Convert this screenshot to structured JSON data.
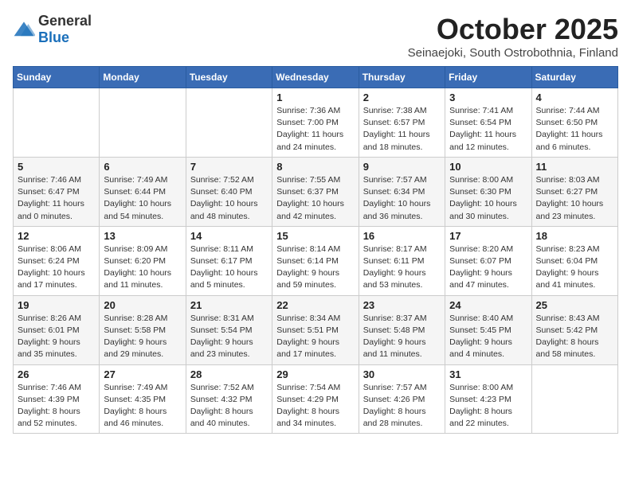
{
  "logo": {
    "general": "General",
    "blue": "Blue"
  },
  "title": "October 2025",
  "subtitle": "Seinaejoki, South Ostrobothnia, Finland",
  "headers": [
    "Sunday",
    "Monday",
    "Tuesday",
    "Wednesday",
    "Thursday",
    "Friday",
    "Saturday"
  ],
  "weeks": [
    [
      {
        "day": "",
        "info": ""
      },
      {
        "day": "",
        "info": ""
      },
      {
        "day": "",
        "info": ""
      },
      {
        "day": "1",
        "info": "Sunrise: 7:36 AM\nSunset: 7:00 PM\nDaylight: 11 hours\nand 24 minutes."
      },
      {
        "day": "2",
        "info": "Sunrise: 7:38 AM\nSunset: 6:57 PM\nDaylight: 11 hours\nand 18 minutes."
      },
      {
        "day": "3",
        "info": "Sunrise: 7:41 AM\nSunset: 6:54 PM\nDaylight: 11 hours\nand 12 minutes."
      },
      {
        "day": "4",
        "info": "Sunrise: 7:44 AM\nSunset: 6:50 PM\nDaylight: 11 hours\nand 6 minutes."
      }
    ],
    [
      {
        "day": "5",
        "info": "Sunrise: 7:46 AM\nSunset: 6:47 PM\nDaylight: 11 hours\nand 0 minutes."
      },
      {
        "day": "6",
        "info": "Sunrise: 7:49 AM\nSunset: 6:44 PM\nDaylight: 10 hours\nand 54 minutes."
      },
      {
        "day": "7",
        "info": "Sunrise: 7:52 AM\nSunset: 6:40 PM\nDaylight: 10 hours\nand 48 minutes."
      },
      {
        "day": "8",
        "info": "Sunrise: 7:55 AM\nSunset: 6:37 PM\nDaylight: 10 hours\nand 42 minutes."
      },
      {
        "day": "9",
        "info": "Sunrise: 7:57 AM\nSunset: 6:34 PM\nDaylight: 10 hours\nand 36 minutes."
      },
      {
        "day": "10",
        "info": "Sunrise: 8:00 AM\nSunset: 6:30 PM\nDaylight: 10 hours\nand 30 minutes."
      },
      {
        "day": "11",
        "info": "Sunrise: 8:03 AM\nSunset: 6:27 PM\nDaylight: 10 hours\nand 23 minutes."
      }
    ],
    [
      {
        "day": "12",
        "info": "Sunrise: 8:06 AM\nSunset: 6:24 PM\nDaylight: 10 hours\nand 17 minutes."
      },
      {
        "day": "13",
        "info": "Sunrise: 8:09 AM\nSunset: 6:20 PM\nDaylight: 10 hours\nand 11 minutes."
      },
      {
        "day": "14",
        "info": "Sunrise: 8:11 AM\nSunset: 6:17 PM\nDaylight: 10 hours\nand 5 minutes."
      },
      {
        "day": "15",
        "info": "Sunrise: 8:14 AM\nSunset: 6:14 PM\nDaylight: 9 hours\nand 59 minutes."
      },
      {
        "day": "16",
        "info": "Sunrise: 8:17 AM\nSunset: 6:11 PM\nDaylight: 9 hours\nand 53 minutes."
      },
      {
        "day": "17",
        "info": "Sunrise: 8:20 AM\nSunset: 6:07 PM\nDaylight: 9 hours\nand 47 minutes."
      },
      {
        "day": "18",
        "info": "Sunrise: 8:23 AM\nSunset: 6:04 PM\nDaylight: 9 hours\nand 41 minutes."
      }
    ],
    [
      {
        "day": "19",
        "info": "Sunrise: 8:26 AM\nSunset: 6:01 PM\nDaylight: 9 hours\nand 35 minutes."
      },
      {
        "day": "20",
        "info": "Sunrise: 8:28 AM\nSunset: 5:58 PM\nDaylight: 9 hours\nand 29 minutes."
      },
      {
        "day": "21",
        "info": "Sunrise: 8:31 AM\nSunset: 5:54 PM\nDaylight: 9 hours\nand 23 minutes."
      },
      {
        "day": "22",
        "info": "Sunrise: 8:34 AM\nSunset: 5:51 PM\nDaylight: 9 hours\nand 17 minutes."
      },
      {
        "day": "23",
        "info": "Sunrise: 8:37 AM\nSunset: 5:48 PM\nDaylight: 9 hours\nand 11 minutes."
      },
      {
        "day": "24",
        "info": "Sunrise: 8:40 AM\nSunset: 5:45 PM\nDaylight: 9 hours\nand 4 minutes."
      },
      {
        "day": "25",
        "info": "Sunrise: 8:43 AM\nSunset: 5:42 PM\nDaylight: 8 hours\nand 58 minutes."
      }
    ],
    [
      {
        "day": "26",
        "info": "Sunrise: 7:46 AM\nSunset: 4:39 PM\nDaylight: 8 hours\nand 52 minutes."
      },
      {
        "day": "27",
        "info": "Sunrise: 7:49 AM\nSunset: 4:35 PM\nDaylight: 8 hours\nand 46 minutes."
      },
      {
        "day": "28",
        "info": "Sunrise: 7:52 AM\nSunset: 4:32 PM\nDaylight: 8 hours\nand 40 minutes."
      },
      {
        "day": "29",
        "info": "Sunrise: 7:54 AM\nSunset: 4:29 PM\nDaylight: 8 hours\nand 34 minutes."
      },
      {
        "day": "30",
        "info": "Sunrise: 7:57 AM\nSunset: 4:26 PM\nDaylight: 8 hours\nand 28 minutes."
      },
      {
        "day": "31",
        "info": "Sunrise: 8:00 AM\nSunset: 4:23 PM\nDaylight: 8 hours\nand 22 minutes."
      },
      {
        "day": "",
        "info": ""
      }
    ]
  ]
}
